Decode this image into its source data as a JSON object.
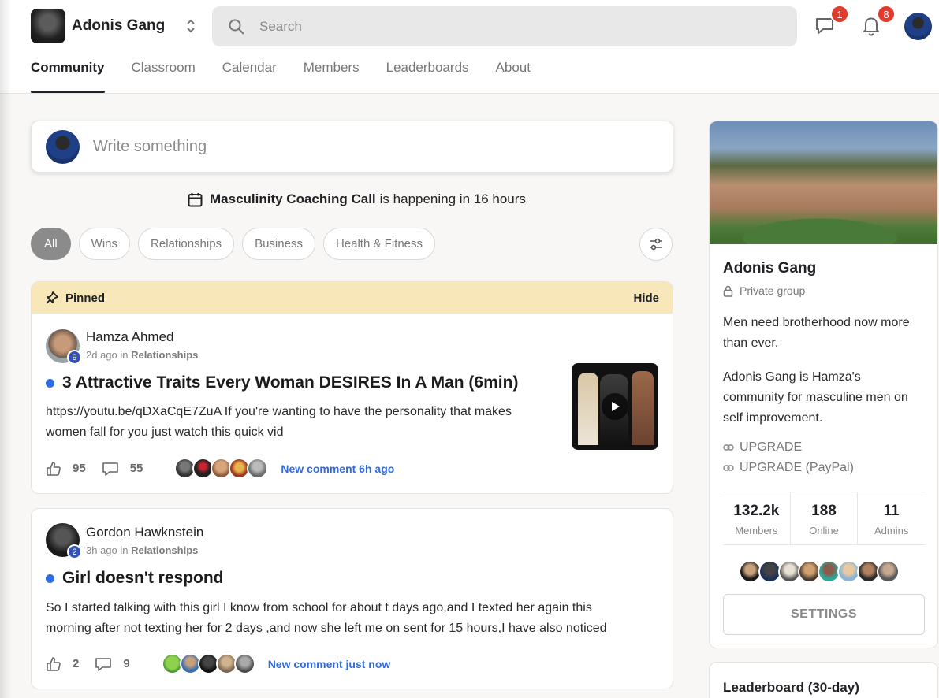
{
  "header": {
    "brand_name": "Adonis Gang",
    "search_placeholder": "Search",
    "chat_badge": "1",
    "notifications_badge": "8"
  },
  "tabs": [
    {
      "label": "Community",
      "active": true
    },
    {
      "label": "Classroom"
    },
    {
      "label": "Calendar"
    },
    {
      "label": "Members"
    },
    {
      "label": "Leaderboards"
    },
    {
      "label": "About"
    }
  ],
  "composer": {
    "placeholder": "Write something"
  },
  "event": {
    "name": "Masculinity Coaching Call",
    "suffix": "is happening in 16 hours"
  },
  "filters": [
    "All",
    "Wins",
    "Relationships",
    "Business",
    "Health & Fitness"
  ],
  "posts": [
    {
      "pinned_label": "Pinned",
      "hide_label": "Hide",
      "author": "Hamza Ahmed",
      "level": "9",
      "time": "2d ago in",
      "category": "Relationships",
      "title": "3 Attractive Traits Every Woman DESIRES In A Man (6min)",
      "body_line1": "https://youtu.be/qDXaCqE7ZuA If you're wanting to have the personality that makes",
      "body_line2": "women fall for you just watch this quick vid",
      "likes": "95",
      "comments": "55",
      "new_comment": "New comment 6h ago"
    },
    {
      "author": "Gordon Hawknstein",
      "level": "2",
      "time": "3h ago in",
      "category": "Relationships",
      "title": "Girl doesn't respond",
      "body_line1": "So I started talking with this girl I know from school for about t days ago,and I texted her again this",
      "body_line2": "morning after not texting her for 2 days ,and now she left me on sent for 15 hours,I have also noticed",
      "likes": "2",
      "comments": "9",
      "new_comment": "New comment just now"
    }
  ],
  "sidebar": {
    "title": "Adonis Gang",
    "privacy": "Private group",
    "desc1_line1": "Men need brotherhood now more",
    "desc1_line2": "than ever.",
    "desc2_line1": "Adonis Gang is Hamza's",
    "desc2_line2": "community for masculine men on",
    "desc2_line3": "self improvement.",
    "link1": "UPGRADE",
    "link2": "UPGRADE (PayPal)",
    "stats": [
      {
        "value": "132.2k",
        "label": "Members"
      },
      {
        "value": "188",
        "label": "Online"
      },
      {
        "value": "11",
        "label": "Admins"
      }
    ],
    "settings_label": "SETTINGS",
    "leaderboard_title": "Leaderboard (30-day)"
  },
  "colors": {
    "accent": "#2f6be3",
    "badge": "#e23b2e",
    "pinned_bg": "#f8e7b8",
    "level": "#3553b7"
  }
}
